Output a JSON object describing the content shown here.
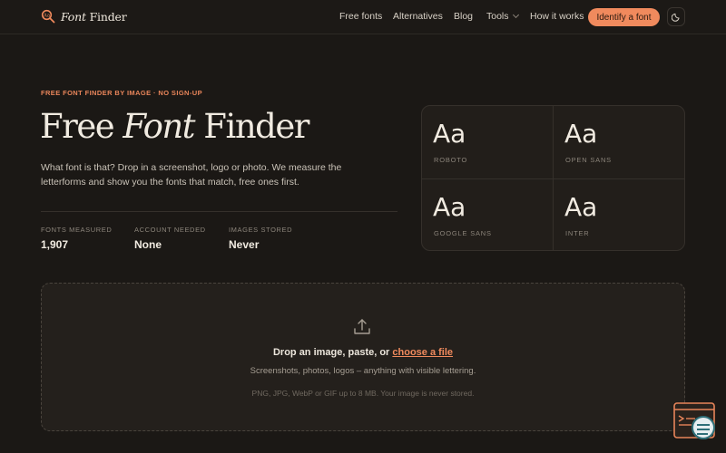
{
  "header": {
    "logo_text_italic": "Font",
    "logo_text_rest": " Finder",
    "nav": [
      {
        "label": "Free fonts"
      },
      {
        "label": "Alternatives"
      },
      {
        "label": "Blog"
      },
      {
        "label": "Tools"
      },
      {
        "label": "How it works"
      }
    ],
    "cta_label": "Identify a font",
    "theme_icon": "moon-icon"
  },
  "hero": {
    "eyebrow": "FREE FONT FINDER BY IMAGE · NO SIGN-UP",
    "title_part1": "Free ",
    "title_italic": "Font",
    "title_part2": " Finder",
    "lede": "What font is that? Drop in a screenshot, logo or photo. We measure the letterforms and show you the fonts that match, free ones first.",
    "stats": [
      {
        "label": "FONTS MEASURED",
        "value": "1,907"
      },
      {
        "label": "ACCOUNT NEEDED",
        "value": "None"
      },
      {
        "label": "IMAGES STORED",
        "value": "Never"
      }
    ]
  },
  "font_samples": [
    {
      "sample": "Aa",
      "name": "ROBOTO"
    },
    {
      "sample": "Aa",
      "name": "OPEN SANS"
    },
    {
      "sample": "Aa",
      "name": "GOOGLE SANS"
    },
    {
      "sample": "Aa",
      "name": "INTER"
    }
  ],
  "dropzone": {
    "title_prefix": "Drop an image, paste, or ",
    "title_link": "choose a file",
    "subtitle": "Screenshots, photos, logos – anything with visible lettering.",
    "note": "PNG, JPG, WebP or GIF up to 8 MB. Your image is never stored."
  },
  "colors": {
    "background": "#1b1815",
    "accent": "#f08a5d",
    "text": "#ece6dc"
  }
}
